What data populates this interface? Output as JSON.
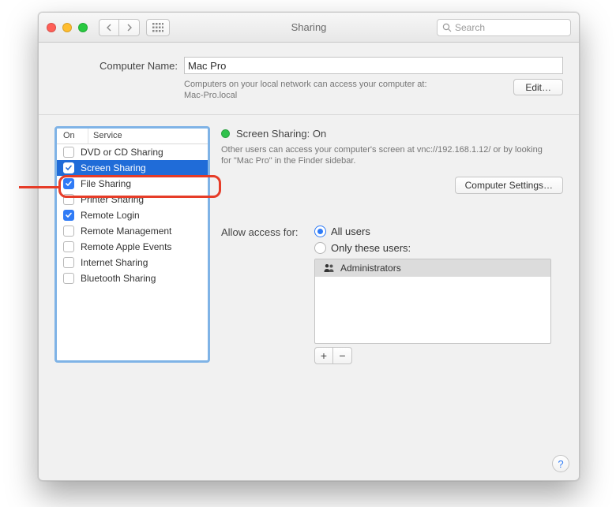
{
  "titlebar": {
    "title": "Sharing",
    "search_placeholder": "Search"
  },
  "computer_name": {
    "label": "Computer Name:",
    "value": "Mac Pro",
    "subtext_line1": "Computers on your local network can access your computer at:",
    "subtext_line2": "Mac-Pro.local",
    "edit_label": "Edit…"
  },
  "services": {
    "header_on": "On",
    "header_service": "Service",
    "items": [
      {
        "label": "DVD or CD Sharing",
        "checked": false
      },
      {
        "label": "Screen Sharing",
        "checked": true
      },
      {
        "label": "File Sharing",
        "checked": true
      },
      {
        "label": "Printer Sharing",
        "checked": false
      },
      {
        "label": "Remote Login",
        "checked": true
      },
      {
        "label": "Remote Management",
        "checked": false
      },
      {
        "label": "Remote Apple Events",
        "checked": false
      },
      {
        "label": "Internet Sharing",
        "checked": false
      },
      {
        "label": "Bluetooth Sharing",
        "checked": false
      }
    ],
    "selected_index": 1
  },
  "detail": {
    "status_label": "Screen Sharing: On",
    "status_desc": "Other users can access your computer's screen at vnc://192.168.1.12/ or by looking for \"Mac Pro\" in the Finder sidebar.",
    "computer_settings_label": "Computer Settings…",
    "allow_label": "Allow access for:",
    "radio_all": "All users",
    "radio_only": "Only these users:",
    "users": [
      {
        "label": "Administrators"
      }
    ],
    "plus": "+",
    "minus": "−"
  },
  "help_label": "?"
}
